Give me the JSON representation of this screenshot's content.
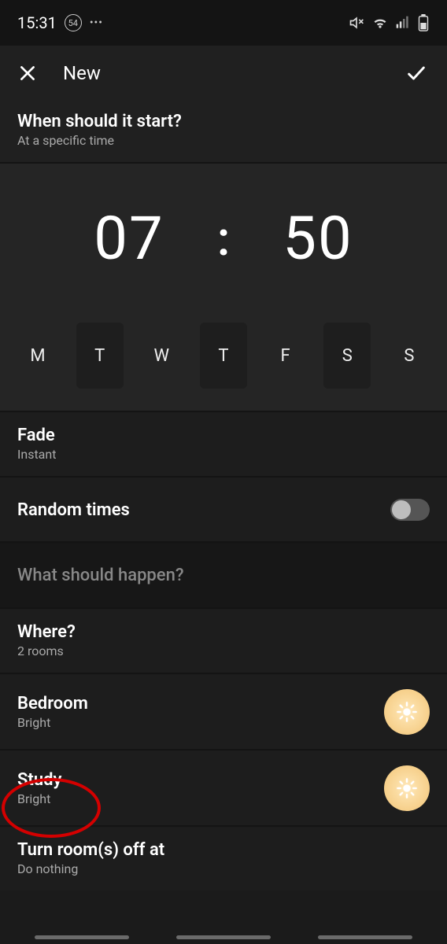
{
  "status": {
    "time": "15:31",
    "badge": "54",
    "more": "•••"
  },
  "header": {
    "title": "New"
  },
  "start": {
    "title": "When should it start?",
    "subtitle": "At a specific time"
  },
  "time": {
    "hour": "07",
    "sep": ":",
    "minute": "50"
  },
  "days": [
    "M",
    "T",
    "W",
    "T",
    "F",
    "S",
    "S"
  ],
  "days_selected": [
    false,
    true,
    false,
    true,
    false,
    true,
    false
  ],
  "fade": {
    "title": "Fade",
    "value": "Instant"
  },
  "random": {
    "title": "Random times",
    "on": false
  },
  "happen": {
    "title": "What should happen?"
  },
  "where": {
    "title": "Where?",
    "subtitle": "2 rooms"
  },
  "rooms": [
    {
      "name": "Bedroom",
      "scene": "Bright"
    },
    {
      "name": "Study",
      "scene": "Bright"
    }
  ],
  "off": {
    "title": "Turn room(s) off at",
    "value": "Do nothing"
  }
}
